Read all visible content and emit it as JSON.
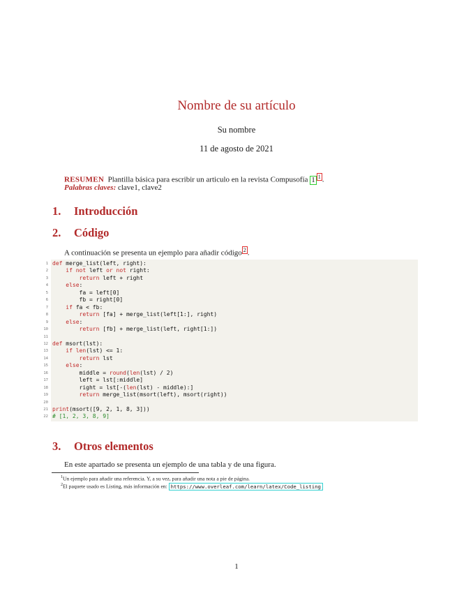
{
  "paper": {
    "title": "Nombre de su artículo",
    "author": "Su nombre",
    "date": "11 de agosto de 2021",
    "abstract": {
      "label": "RESUMEN",
      "text": "Plantilla básica para escribir un articulo en la revista Compusofía",
      "citation": "1",
      "footnote_mark": "1",
      "end": "."
    },
    "keywords": {
      "label": "Palabras claves:",
      "text": "clave1, clave2"
    },
    "sections": [
      {
        "number": "1.",
        "title": "Introducción"
      },
      {
        "number": "2.",
        "title": "Código"
      },
      {
        "number": "3.",
        "title": "Otros elementos"
      }
    ],
    "code_intro": {
      "text": "A continuación se presenta un ejemplo para añadir código",
      "footnote_mark": "2",
      "end": "."
    },
    "section3_text": "En este apartado se presenta un ejemplo de una tabla y de una figura.",
    "footnotes": [
      {
        "mark": "1",
        "text": "Un ejemplo para añadir una referencia. Y, a su vez, para añadir una nota a pie de página."
      },
      {
        "mark": "2",
        "text": "El paquete usado es Listing, más información en: ",
        "url": "https://www.overleaf.com/learn/latex/Code_listing"
      }
    ],
    "page_number": "1"
  },
  "code": {
    "line_numbers": [
      "1",
      "2",
      "3",
      "4",
      "5",
      "6",
      "7",
      "8",
      "9",
      "10",
      "11",
      "12",
      "13",
      "14",
      "15",
      "16",
      "17",
      "18",
      "19",
      "20",
      "21",
      "22"
    ],
    "lines": [
      [
        [
          "k",
          "def"
        ],
        [
          "t",
          " merge_list(left, right):"
        ]
      ],
      [
        [
          "t",
          "    "
        ],
        [
          "k",
          "if not"
        ],
        [
          "t",
          " left "
        ],
        [
          "k",
          "or not"
        ],
        [
          "t",
          " right:"
        ]
      ],
      [
        [
          "t",
          "        "
        ],
        [
          "k",
          "return"
        ],
        [
          "t",
          " left + right"
        ]
      ],
      [
        [
          "t",
          "    "
        ],
        [
          "k",
          "else"
        ],
        [
          "t",
          ":"
        ]
      ],
      [
        [
          "t",
          "        fa = left[0]"
        ]
      ],
      [
        [
          "t",
          "        fb = right[0]"
        ]
      ],
      [
        [
          "t",
          "    "
        ],
        [
          "k",
          "if"
        ],
        [
          "t",
          " fa < fb:"
        ]
      ],
      [
        [
          "t",
          "        "
        ],
        [
          "k",
          "return"
        ],
        [
          "t",
          " [fa] + merge_list(left[1:], right)"
        ]
      ],
      [
        [
          "t",
          "    "
        ],
        [
          "k",
          "else"
        ],
        [
          "t",
          ":"
        ]
      ],
      [
        [
          "t",
          "        "
        ],
        [
          "k",
          "return"
        ],
        [
          "t",
          " [fb] + merge_list(left, right[1:])"
        ]
      ],
      [
        [
          "t",
          ""
        ]
      ],
      [
        [
          "k",
          "def"
        ],
        [
          "t",
          " msort(lst):"
        ]
      ],
      [
        [
          "t",
          "    "
        ],
        [
          "k",
          "if"
        ],
        [
          "t",
          " "
        ],
        [
          "f",
          "len"
        ],
        [
          "t",
          "(lst) <= 1:"
        ]
      ],
      [
        [
          "t",
          "        "
        ],
        [
          "k",
          "return"
        ],
        [
          "t",
          " lst"
        ]
      ],
      [
        [
          "t",
          "    "
        ],
        [
          "k",
          "else"
        ],
        [
          "t",
          ":"
        ]
      ],
      [
        [
          "t",
          "        middle = "
        ],
        [
          "f",
          "round"
        ],
        [
          "t",
          "("
        ],
        [
          "f",
          "len"
        ],
        [
          "t",
          "(lst) / 2)"
        ]
      ],
      [
        [
          "t",
          "        left = lst[:middle]"
        ]
      ],
      [
        [
          "t",
          "        right = lst[-("
        ],
        [
          "f",
          "len"
        ],
        [
          "t",
          "(lst) - middle):]"
        ]
      ],
      [
        [
          "t",
          "        "
        ],
        [
          "k",
          "return"
        ],
        [
          "t",
          " merge_list(msort(left), msort(right))"
        ]
      ],
      [
        [
          "t",
          ""
        ]
      ],
      [
        [
          "f",
          "print"
        ],
        [
          "t",
          "(msort([9, 2, 1, 8, 3]))"
        ]
      ],
      [
        [
          "c",
          "# [1, 2, 3, 8, 9]"
        ]
      ]
    ]
  }
}
